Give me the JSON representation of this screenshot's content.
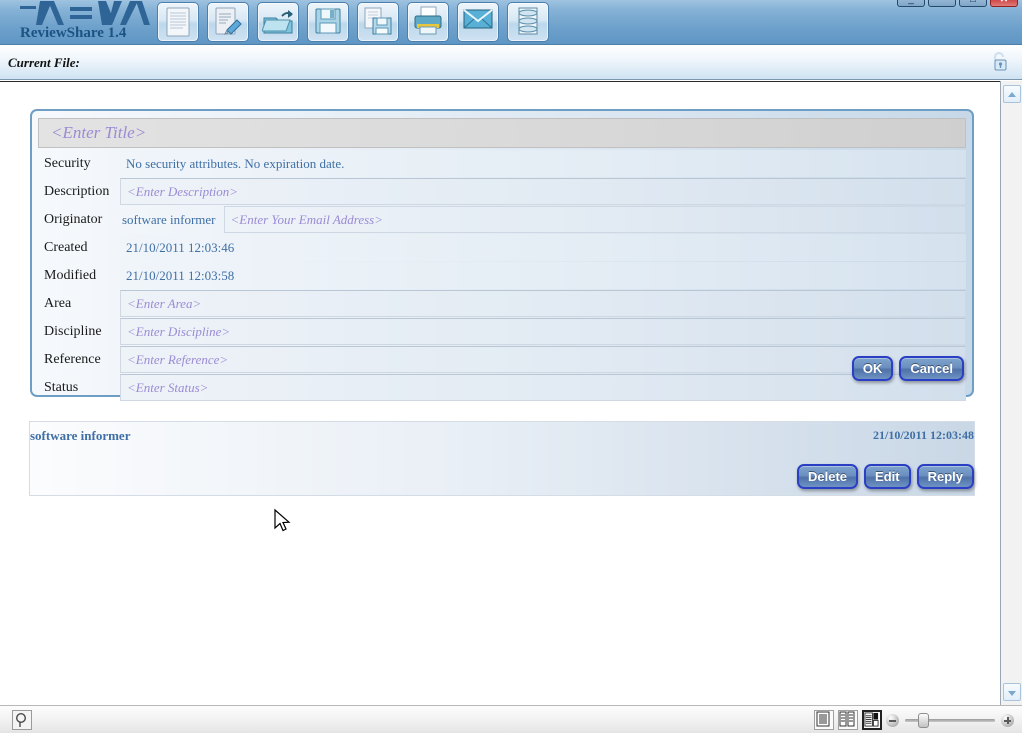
{
  "app": {
    "brand": "AVEVA",
    "product": "ReviewShare 1.4",
    "accent": "#2f6496",
    "link_color": "#3f6fa5",
    "placeholder_color": "#9b8bd4"
  },
  "window_controls": [
    {
      "name": "minimize",
      "glyph": "_"
    },
    {
      "name": "restore-down",
      "glyph": "–"
    },
    {
      "name": "maximize",
      "glyph": "□"
    },
    {
      "name": "close",
      "glyph": "✕"
    }
  ],
  "toolbar": {
    "buttons": [
      {
        "name": "new-document-icon",
        "tooltip": "New"
      },
      {
        "name": "annotate-icon",
        "tooltip": "Annotate"
      },
      {
        "name": "open-folder-icon",
        "tooltip": "Open"
      },
      {
        "name": "save-icon",
        "tooltip": "Save"
      },
      {
        "name": "save-as-icon",
        "tooltip": "Save As"
      },
      {
        "name": "print-icon",
        "tooltip": "Print"
      },
      {
        "name": "email-icon",
        "tooltip": "Email"
      },
      {
        "name": "database-icon",
        "tooltip": "Database"
      }
    ]
  },
  "filebar": {
    "label": "Current File:",
    "value": "",
    "lock_icon": "unlocked-padlock-icon"
  },
  "form": {
    "title_placeholder": "<Enter Title>",
    "title_value": "",
    "rows": [
      {
        "label": "Security",
        "type": "text",
        "value": "No security attributes. No expiration date.",
        "placeholder": ""
      },
      {
        "label": "Description",
        "type": "input",
        "value": "",
        "placeholder": "<Enter Description>"
      },
      {
        "label": "Originator",
        "type": "originator",
        "value": "software informer",
        "placeholder": "<Enter Your Email Address>"
      },
      {
        "label": "Created",
        "type": "text",
        "value": "21/10/2011 12:03:46",
        "placeholder": ""
      },
      {
        "label": "Modified",
        "type": "text",
        "value": "21/10/2011 12:03:58",
        "placeholder": ""
      },
      {
        "label": "Area",
        "type": "input",
        "value": "",
        "placeholder": "<Enter Area>"
      },
      {
        "label": "Discipline",
        "type": "input",
        "value": "",
        "placeholder": "<Enter Discipline>"
      },
      {
        "label": "Reference",
        "type": "input",
        "value": "",
        "placeholder": "<Enter Reference>"
      },
      {
        "label": "Status",
        "type": "input",
        "value": "",
        "placeholder": "<Enter Status>"
      }
    ],
    "ok_label": "OK",
    "cancel_label": "Cancel"
  },
  "comment": {
    "author": "software informer",
    "timestamp": "21/10/2011 12:03:48",
    "body": "",
    "delete_label": "Delete",
    "edit_label": "Edit",
    "reply_label": "Reply"
  },
  "statusbar": {
    "search_icon": "magnifier-icon",
    "view_modes": [
      {
        "name": "single-page-view-icon",
        "active": false
      },
      {
        "name": "two-page-view-icon",
        "active": false
      },
      {
        "name": "thumbnail-view-icon",
        "active": true
      }
    ],
    "zoom_out_icon": "zoom-out-icon",
    "zoom_in_icon": "zoom-in-icon",
    "zoom_percent": "14"
  }
}
